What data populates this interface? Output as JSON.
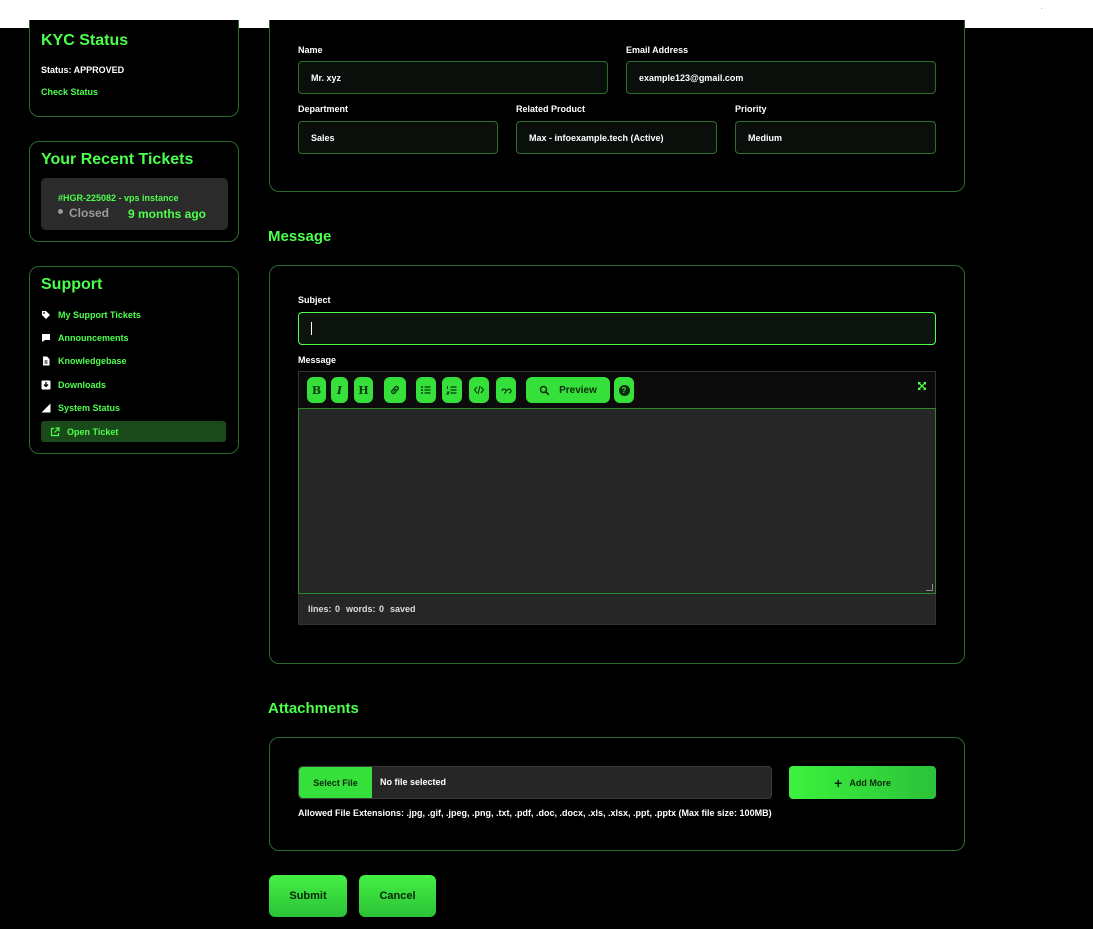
{
  "kyc": {
    "title": "KYC Status",
    "status": "Status: APPROVED",
    "check": "Check Status"
  },
  "recent": {
    "title": "Your Recent Tickets",
    "ticket_id": "#HGR-225082 - vps instance",
    "ticket_state": "Closed",
    "ticket_ago": "9 months ago"
  },
  "support": {
    "title": "Support",
    "items": [
      {
        "label": "My Support Tickets",
        "icon": "tag-icon"
      },
      {
        "label": "Announcements",
        "icon": "comment-icon"
      },
      {
        "label": "Knowledgebase",
        "icon": "document-icon"
      },
      {
        "label": "Downloads",
        "icon": "download-icon"
      },
      {
        "label": "System Status",
        "icon": "signal-icon"
      },
      {
        "label": "Open Ticket",
        "icon": "external-link-icon"
      }
    ]
  },
  "form": {
    "name_label": "Name",
    "name_value": "Mr. xyz",
    "email_label": "Email Address",
    "email_value": "example123@gmail.com",
    "dept_label": "Department",
    "dept_value": "Sales",
    "product_label": "Related Product",
    "product_value": "Max - infoexample.tech (Active)",
    "priority_label": "Priority",
    "priority_value": "Medium"
  },
  "message": {
    "section_title": "Message",
    "subject_label": "Subject",
    "subject_value": "",
    "message_label": "Message",
    "toolbar": {
      "bold": "B",
      "italic": "I",
      "heading": "H",
      "preview": "Preview",
      "help": "?"
    },
    "status": {
      "lines": "lines: 0",
      "words": "words: 0",
      "saved": "saved"
    }
  },
  "attachments": {
    "section_title": "Attachments",
    "select_file": "Select File",
    "no_file": "No file selected",
    "add_more": "Add More",
    "allowed": "Allowed File Extensions: .jpg, .gif, .jpeg, .png, .txt, .pdf, .doc, .docx, .xls, .xlsx, .ppt, .pptx (Max file size: 100MB)"
  },
  "actions": {
    "submit": "Submit",
    "cancel": "Cancel"
  },
  "colors": {
    "accent": "#4cff4c",
    "button": "#36e03a",
    "border": "#2a6a2a",
    "background": "#000000"
  }
}
